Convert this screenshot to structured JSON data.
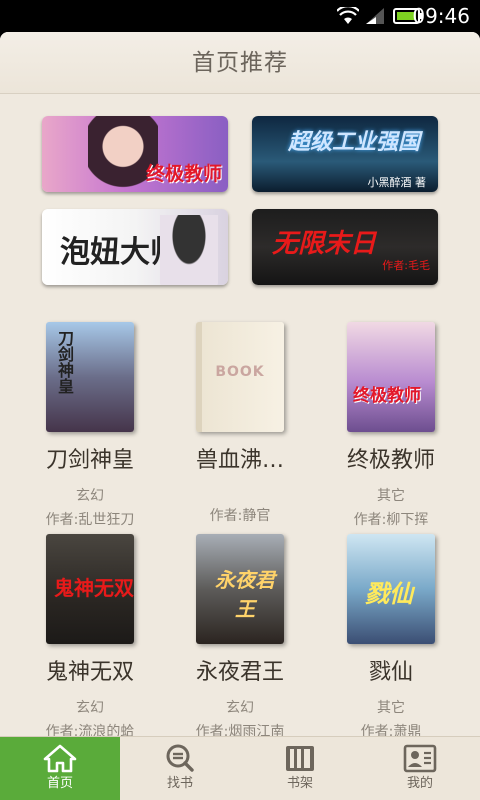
{
  "status_bar": {
    "time": "09:46"
  },
  "header": {
    "title": "首页推荐"
  },
  "banners": [
    {
      "text": "终极教师"
    },
    {
      "text": "超级工业强国",
      "author": "小黑醉酒 著"
    },
    {
      "text": "泡妞大师"
    },
    {
      "text": "无限末日",
      "sub": "作者:毛毛"
    }
  ],
  "books": [
    {
      "title": "刀剑神皇",
      "category": "玄幻",
      "author": "作者:乱世狂刀",
      "cover_text": "刀剑神皇"
    },
    {
      "title": "兽血沸…",
      "category": "",
      "author": "作者:静官",
      "cover_text": "BOOK"
    },
    {
      "title": "终极教师",
      "category": "其它",
      "author": "作者:柳下挥",
      "cover_text": "终极教师"
    },
    {
      "title": "鬼神无双",
      "category": "玄幻",
      "author": "作者:流浪的蛤",
      "cover_text": "鬼神无双"
    },
    {
      "title": "永夜君王",
      "category": "玄幻",
      "author": "作者:烟雨江南",
      "cover_text": "永夜君王"
    },
    {
      "title": "戮仙",
      "category": "其它",
      "author": "作者:萧鼎",
      "cover_text": "戮仙"
    }
  ],
  "nav": [
    {
      "label": "首页",
      "icon": "home-icon"
    },
    {
      "label": "找书",
      "icon": "search-icon"
    },
    {
      "label": "书架",
      "icon": "bookshelf-icon"
    },
    {
      "label": "我的",
      "icon": "profile-icon"
    }
  ],
  "colors": {
    "nav_active": "#5aab3a",
    "page_bg": "#efe9df"
  }
}
